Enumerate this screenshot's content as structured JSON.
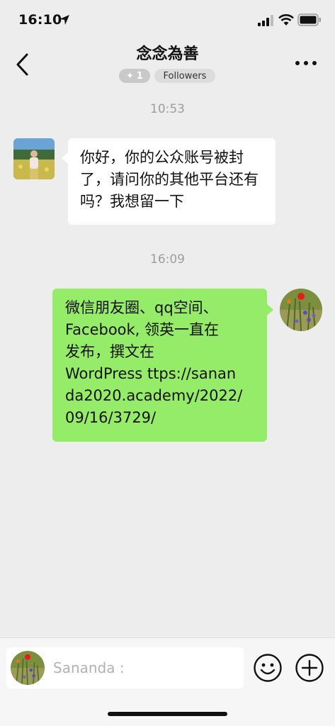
{
  "status_bar": {
    "time": "16:10"
  },
  "header": {
    "title": "念念為善",
    "star_count": "1",
    "followers_label": "Followers"
  },
  "messages": [
    {
      "timestamp": "10:53",
      "sender": "other",
      "text": "你好，你的公众账号被封了，请问你的其他平台还有吗？我想留一下"
    },
    {
      "timestamp": "16:09",
      "sender": "me",
      "text": "微信朋友圈、qq空间、\nFacebook, 领英一直在\n发布，撰文在\nWordPress ttps://sanan\nda2020.academy/2022/\n09/16/3729/"
    }
  ],
  "input": {
    "placeholder": "Sananda :"
  },
  "colors": {
    "background": "#ededed",
    "bubble_out": "#95ec69",
    "bubble_in": "#ffffff"
  },
  "icons": [
    "location-arrow-icon",
    "signal-icon",
    "wifi-icon",
    "battery-icon",
    "back-icon",
    "more-icon",
    "emoji-icon",
    "plus-icon"
  ]
}
